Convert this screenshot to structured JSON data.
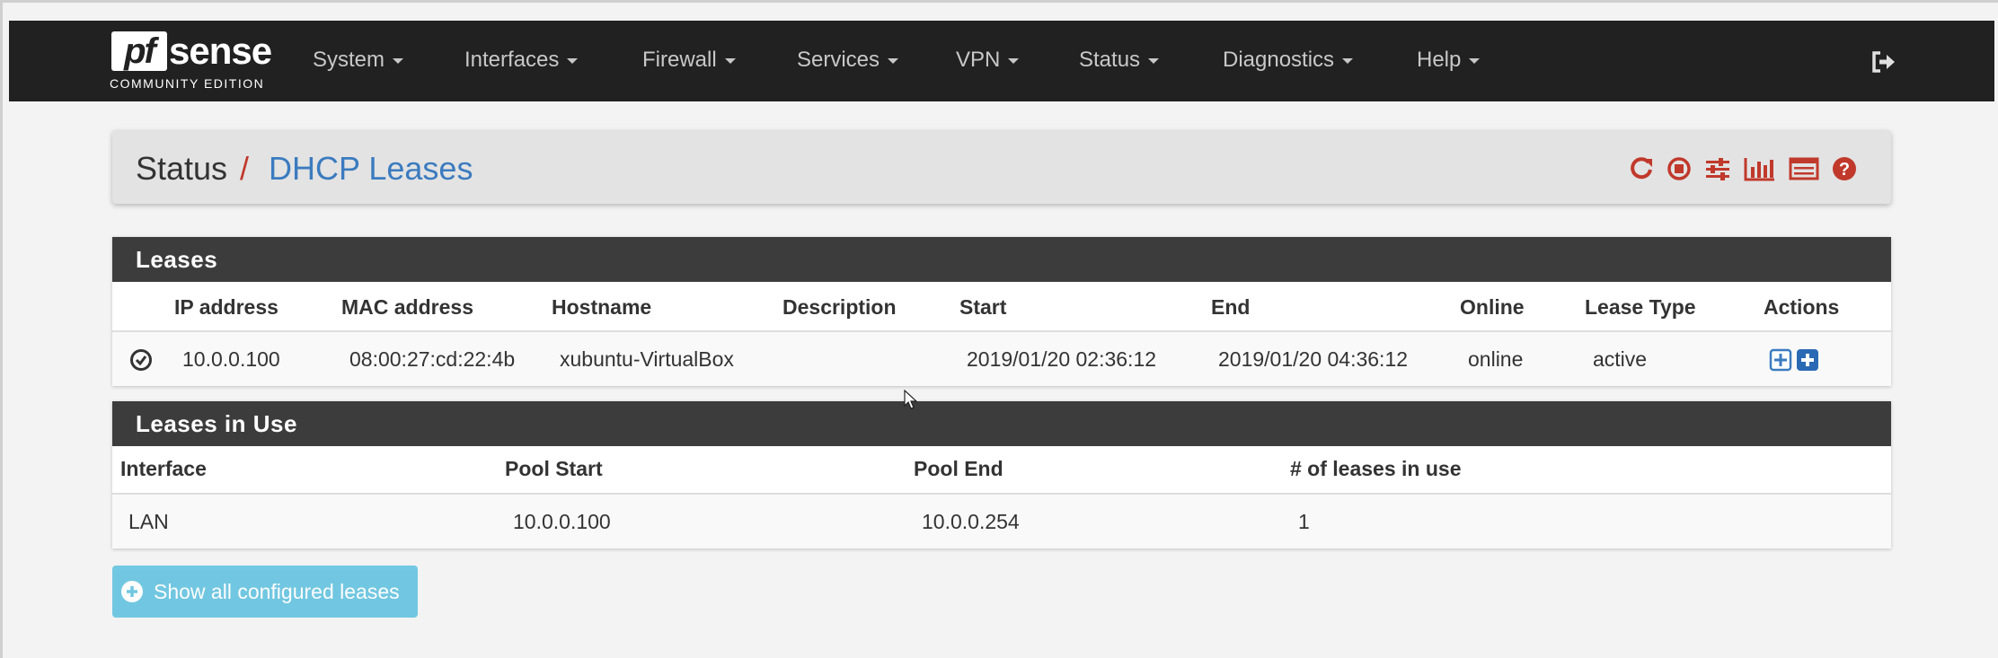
{
  "brand": {
    "logo_pf": "pf",
    "logo_sense": "sense",
    "edition": "COMMUNITY EDITION"
  },
  "nav": [
    {
      "label": "System"
    },
    {
      "label": "Interfaces"
    },
    {
      "label": "Firewall"
    },
    {
      "label": "Services"
    },
    {
      "label": "VPN"
    },
    {
      "label": "Status"
    },
    {
      "label": "Diagnostics"
    },
    {
      "label": "Help"
    }
  ],
  "breadcrumb": {
    "parent": "Status",
    "separator": "/",
    "current": "DHCP Leases"
  },
  "toolbar_icons": [
    "refresh-icon",
    "stop-icon",
    "settings-sliders-icon",
    "bar-chart-icon",
    "list-icon",
    "help-icon"
  ],
  "leases": {
    "title": "Leases",
    "columns": [
      "IP address",
      "MAC address",
      "Hostname",
      "Description",
      "Start",
      "End",
      "Online",
      "Lease Type",
      "Actions"
    ],
    "rows": [
      {
        "status_icon": "check-circle-icon",
        "ip": "10.0.0.100",
        "mac": "08:00:27:cd:22:4b",
        "hostname": "xubuntu-VirtualBox",
        "description": "",
        "start": "2019/01/20 02:36:12",
        "end": "2019/01/20 04:36:12",
        "online": "online",
        "lease_type": "active",
        "actions": [
          "add-static-mapping-icon",
          "add-wol-mapping-icon"
        ]
      }
    ]
  },
  "leases_in_use": {
    "title": "Leases in Use",
    "columns": [
      "Interface",
      "Pool Start",
      "Pool End",
      "# of leases in use"
    ],
    "rows": [
      {
        "interface": "LAN",
        "pool_start": "10.0.0.100",
        "pool_end": "10.0.0.254",
        "count": "1"
      }
    ]
  },
  "show_all_button": {
    "label": "Show all configured leases"
  },
  "colors": {
    "navbar": "#212121",
    "accent_red": "#c0392b",
    "accent_blue": "#3b7bbf",
    "button": "#5bc0de",
    "panel_heading": "#3c3c3c"
  }
}
